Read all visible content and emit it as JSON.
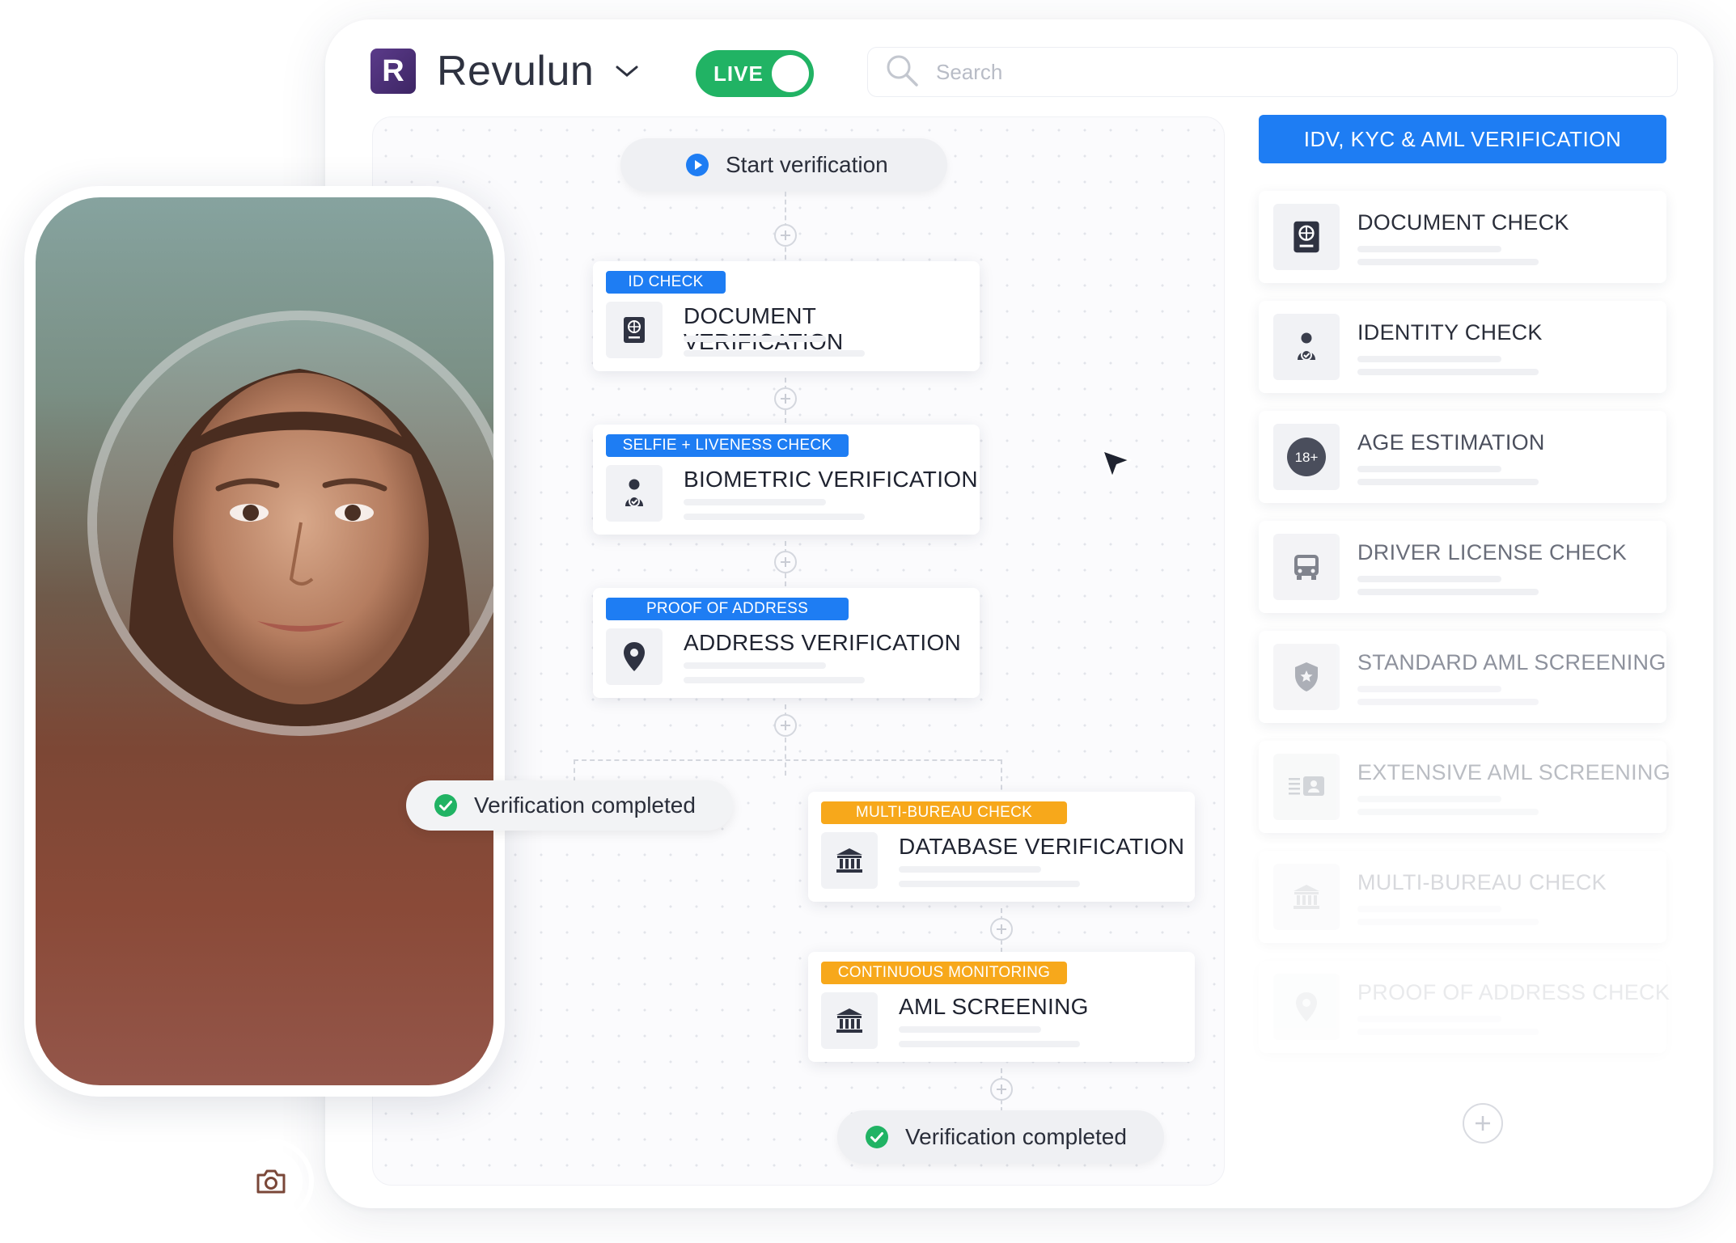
{
  "brand": {
    "logo_letter": "R",
    "name": "Revulun",
    "chevron_icon": "chevron-down-icon"
  },
  "live_toggle": {
    "label": "LIVE",
    "state": "on",
    "color": "#21b364"
  },
  "search": {
    "placeholder": "Search",
    "value": "",
    "icon": "search-icon"
  },
  "workflow": {
    "start_label": "Start verification",
    "steps": [
      {
        "tag": "ID CHECK",
        "tag_color": "#1e7df3",
        "title": "DOCUMENT VERIFICATION",
        "icon": "passport-icon"
      },
      {
        "tag": "SELFIE + LIVENESS CHECK",
        "tag_color": "#1e7df3",
        "title": "BIOMETRIC VERIFICATION",
        "icon": "person-check-icon"
      },
      {
        "tag": "PROOF OF ADDRESS",
        "tag_color": "#1e7df3",
        "title": "ADDRESS VERIFICATION",
        "icon": "location-pin-icon"
      },
      {
        "tag": "MULTI-BUREAU CHECK",
        "tag_color": "#f7a81b",
        "title": "DATABASE VERIFICATION",
        "icon": "bank-icon"
      },
      {
        "tag": "CONTINUOUS MONITORING",
        "tag_color": "#f7a81b",
        "title": "AML SCREENING",
        "icon": "bank-icon"
      }
    ],
    "completed_left": "Verification completed",
    "completed_bottom": "Verification completed"
  },
  "panel": {
    "header": "IDV, KYC & AML VERIFICATION",
    "checks": [
      {
        "title": "DOCUMENT CHECK",
        "icon": "passport-icon",
        "opacity": 1.0
      },
      {
        "title": "IDENTITY CHECK",
        "icon": "person-check-icon",
        "opacity": 1.0
      },
      {
        "title": "AGE ESTIMATION",
        "icon": "age-18-icon",
        "icon_text": "18+",
        "opacity": 1.0
      },
      {
        "title": "DRIVER LICENSE CHECK",
        "icon": "bus-icon",
        "opacity": 0.85
      },
      {
        "title": "STANDARD AML SCREENING",
        "icon": "shield-star-icon",
        "opacity": 0.7
      },
      {
        "title": "EXTENSIVE AML SCREENING",
        "icon": "id-card-icon",
        "opacity": 0.5
      },
      {
        "title": "MULTI-BUREAU CHECK",
        "icon": "bank-icon",
        "opacity": 0.32
      },
      {
        "title": "PROOF OF ADDRESS CHECK",
        "icon": "location-pin-icon",
        "opacity": 0.16
      }
    ],
    "add_icon": "plus-circle-icon"
  },
  "phone": {
    "shutter_icon": "camera-icon"
  },
  "colors": {
    "accent_blue": "#1e7df3",
    "accent_orange": "#f7a81b",
    "success_green": "#21b364"
  }
}
